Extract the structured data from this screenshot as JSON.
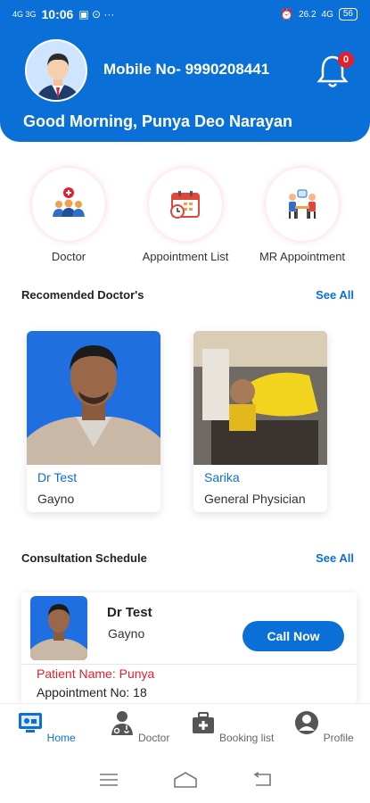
{
  "status_bar": {
    "time": "10:06",
    "left_icons": "4G 3G",
    "right_text": "26.2",
    "network": "4G",
    "battery": "56"
  },
  "header": {
    "mobile": "Mobile No- 9990208441",
    "greeting": "Good Morning, Punya Deo Narayan",
    "notification_count": "0"
  },
  "quick_actions": [
    {
      "label": "Doctor",
      "icon": "doctor-team-icon"
    },
    {
      "label": "Appointment List",
      "icon": "calendar-icon"
    },
    {
      "label": "MR Appointment",
      "icon": "meeting-icon"
    }
  ],
  "recommended": {
    "title": "Recomended Doctor's",
    "see_all": "See All",
    "doctors": [
      {
        "name": "Dr Test",
        "speciality": "Gayno"
      },
      {
        "name": "Sarika",
        "speciality": "General Physician"
      }
    ]
  },
  "schedule": {
    "title": "Consultation Schedule",
    "see_all": "See All",
    "doctor_name": "Dr Test",
    "speciality": "Gayno",
    "call_label": "Call Now",
    "patient": "Patient Name: Punya",
    "appointment": "Appointment No: 18"
  },
  "bottom_nav": [
    {
      "label": "Home",
      "icon": "home-monitor-icon",
      "active": true
    },
    {
      "label": "Doctor",
      "icon": "doctor-icon"
    },
    {
      "label": "Booking list",
      "icon": "medical-kit-icon"
    },
    {
      "label": "Profile",
      "icon": "profile-icon"
    }
  ],
  "colors": {
    "primary": "#0b6fd8",
    "accent_red": "#e21f2b"
  }
}
